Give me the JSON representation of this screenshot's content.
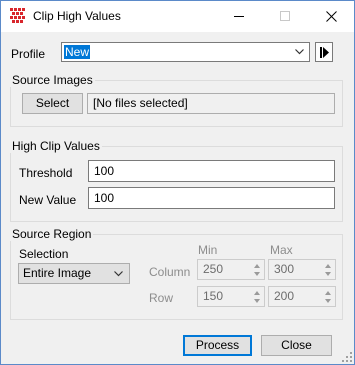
{
  "window": {
    "title": "Clip High Values"
  },
  "profile": {
    "label": "Profile",
    "value": "New"
  },
  "source_images": {
    "title": "Source Images",
    "select_label": "Select",
    "files_text": "[No files selected]"
  },
  "high_clip": {
    "title": "High Clip Values",
    "threshold_label": "Threshold",
    "threshold_value": "100",
    "new_value_label": "New Value",
    "new_value_value": "100"
  },
  "source_region": {
    "title": "Source Region",
    "selection_label": "Selection",
    "selection_value": "Entire Image",
    "min_header": "Min",
    "max_header": "Max",
    "column_label": "Column",
    "row_label": "Row",
    "column_min": "250",
    "column_max": "300",
    "row_min": "150",
    "row_max": "200"
  },
  "buttons": {
    "process": "Process",
    "close": "Close"
  },
  "colors": {
    "accent": "#0078d7",
    "border": "#5b8ac9",
    "icon_red": "#d8262c"
  }
}
